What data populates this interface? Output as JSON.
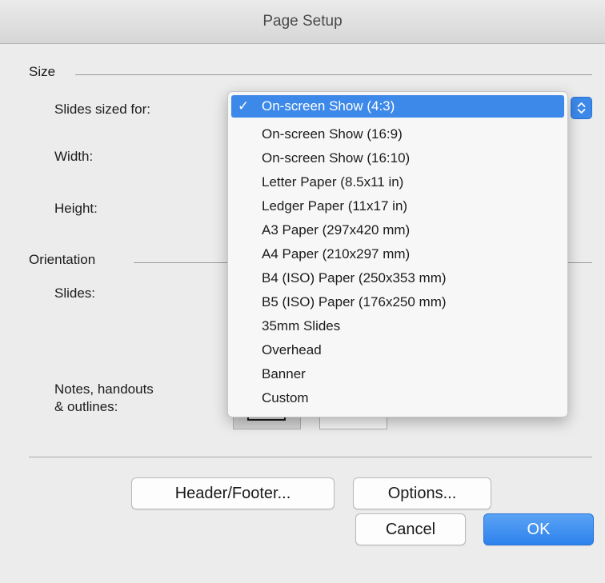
{
  "window": {
    "title": "Page Setup"
  },
  "size_section": {
    "title": "Size",
    "slides_sized_for_label": "Slides sized for:",
    "width_label": "Width:",
    "height_label": "Height:"
  },
  "orientation_section": {
    "title": "Orientation",
    "slides_label": "Slides:",
    "notes_label_line1": "Notes, handouts",
    "notes_label_line2": "& outlines:"
  },
  "slide_size_menu": {
    "check_mark": "✓",
    "items": [
      {
        "label": "On-screen Show (4:3)",
        "selected": true
      },
      {
        "label": "On-screen Show (16:9)"
      },
      {
        "label": "On-screen Show (16:10)"
      },
      {
        "label": "Letter Paper (8.5x11 in)"
      },
      {
        "label": "Ledger Paper (11x17 in)"
      },
      {
        "label": "A3 Paper (297x420 mm)"
      },
      {
        "label": "A4 Paper (210x297 mm)"
      },
      {
        "label": "B4 (ISO) Paper (250x353 mm)"
      },
      {
        "label": "B5 (ISO) Paper (176x250 mm)"
      },
      {
        "label": "35mm Slides"
      },
      {
        "label": "Overhead"
      },
      {
        "label": "Banner"
      },
      {
        "label": "Custom"
      }
    ]
  },
  "buttons": {
    "header_footer": "Header/Footer...",
    "options": "Options...",
    "cancel": "Cancel",
    "ok": "OK"
  },
  "colors": {
    "accent": "#3d89ea",
    "dialog_background": "#ececec"
  },
  "icons": {
    "popup_stepper": "up-down-chevron-icon"
  }
}
